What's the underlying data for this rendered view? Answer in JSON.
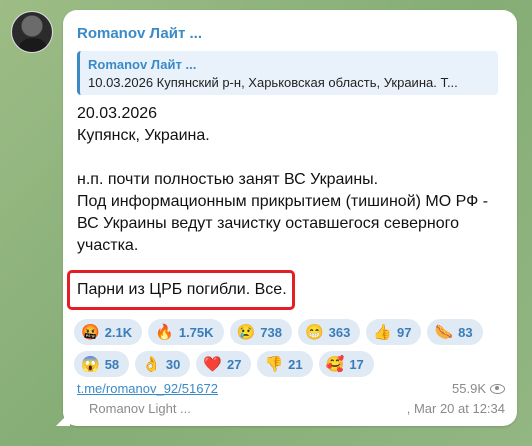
{
  "message": {
    "sender": "Romanov Лайт ...",
    "reply": {
      "sender": "Romanov Лайт ...",
      "text": "10.03.2026 Купянский р-н, Харьковская область, Украина. Т..."
    },
    "body": {
      "date": "20.03.2026",
      "location": "Купянск, Украина.",
      "line1": "н.п. почти полностью занят ВС Украины.",
      "line2": "Под информационным прикрытием (тишиной) МО РФ -",
      "line3": "ВС Украины ведут зачистку оставшегося северного",
      "line4": "участка."
    },
    "highlighted": "Парни из ЦРБ погибли. Все.",
    "highlight_color": "#e31e24",
    "reactions_row1": [
      {
        "emoji": "🤬",
        "count": "2.1K"
      },
      {
        "emoji": "🔥",
        "count": "1.75K"
      },
      {
        "emoji": "😢",
        "count": "738"
      },
      {
        "emoji": "😁",
        "count": "363"
      },
      {
        "emoji": "👍",
        "count": "97"
      },
      {
        "emoji": "🌭",
        "count": "83"
      }
    ],
    "reactions_row2": [
      {
        "emoji": "😱",
        "count": "58"
      },
      {
        "emoji": "👌",
        "count": "30"
      },
      {
        "emoji": "❤️",
        "count": "27"
      },
      {
        "emoji": "👎",
        "count": "21"
      },
      {
        "emoji": "🥰",
        "count": "17"
      }
    ],
    "link": "t.me/romanov_92/51672",
    "views": "55.9K",
    "author": "Romanov Light ...",
    "timestamp": ", Mar 20 at 12:34"
  },
  "colors": {
    "accent": "#3a8ac8",
    "reaction_bg": "#dfeaf5",
    "background": "#8fb27d"
  }
}
